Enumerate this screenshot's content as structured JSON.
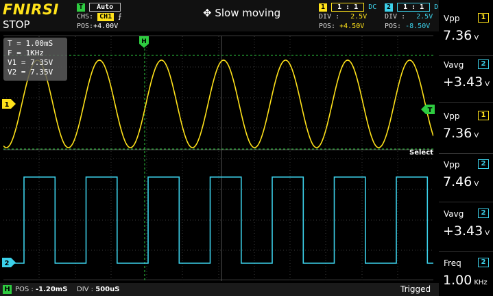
{
  "header": {
    "brand": "FNIRSI",
    "run_state": "STOP",
    "trigger": {
      "tag": "T",
      "mode": "Auto",
      "chs_label": "CHS:",
      "chs_value": "CH1",
      "edge_symbol": "⨍",
      "pos_label": "POS:",
      "pos_value": "+4.00V"
    },
    "mode_text": "Slow moving",
    "ch1": {
      "tag": "1",
      "probe": "1 : 1",
      "coupling": "DC",
      "div_label": "DIV :",
      "div_value": "2.5V",
      "pos_label": "POS:",
      "pos_value": "+4.50V"
    },
    "ch2": {
      "tag": "2",
      "probe": "1 : 1",
      "coupling": "DC",
      "div_label": "DIV :",
      "div_value": "2.5V",
      "pos_label": "POS:",
      "pos_value": "-8.50V"
    }
  },
  "info_box": {
    "lines": [
      "T = 1.00mS",
      "F = 1KHz",
      "V1 = 7.35V",
      "V2 = 7.35V"
    ]
  },
  "markers": {
    "horizontal": "H",
    "ch1": "1",
    "ch2": "2",
    "trigger": "T"
  },
  "select_label": "Select",
  "footer": {
    "h_tag": "H",
    "pos_label": "POS :",
    "pos_value": "-1.20mS",
    "div_label": "DIV :",
    "div_value": "500uS",
    "status": "Trigged"
  },
  "measurements": [
    {
      "name": "Vpp",
      "channel": "1",
      "value": "7.36",
      "unit": "V"
    },
    {
      "name": "Vavg",
      "channel": "2",
      "value": "+3.43",
      "unit": "V"
    },
    {
      "name": "Vpp",
      "channel": "1",
      "value": "7.36",
      "unit": "V"
    },
    {
      "name": "Vpp",
      "channel": "2",
      "value": "7.46",
      "unit": "V"
    },
    {
      "name": "Vavg",
      "channel": "2",
      "value": "+3.43",
      "unit": "V"
    },
    {
      "name": "Freq",
      "channel": "2",
      "value": "1.00",
      "unit": "KHz"
    }
  ],
  "colors": {
    "ch1": "#ffe21a",
    "ch2": "#3cd1ea",
    "trigger": "#2ecc40",
    "grid": "#3a3a3a"
  }
}
